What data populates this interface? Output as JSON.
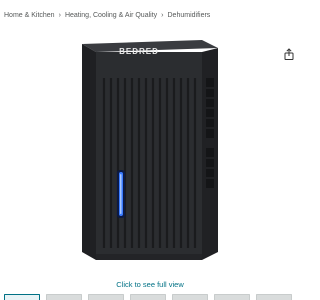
{
  "breadcrumb": [
    {
      "label": "Home & Kitchen"
    },
    {
      "label": "Heating, Cooling & Air Quality"
    },
    {
      "label": "Dehumidifiers"
    }
  ],
  "breadcrumb_separator": "›",
  "product": {
    "brand_text": "BEDRED",
    "image_alt": "BEDRED dehumidifier"
  },
  "gallery": {
    "see_full_view_label": "Click to see full view",
    "thumbnail_count": 7,
    "active_thumbnail": 0
  },
  "icons": {
    "share": "share-icon"
  },
  "colors": {
    "link": "#007185",
    "device_body": "#2b2d30",
    "indicator_blue": "#3a7bff"
  }
}
